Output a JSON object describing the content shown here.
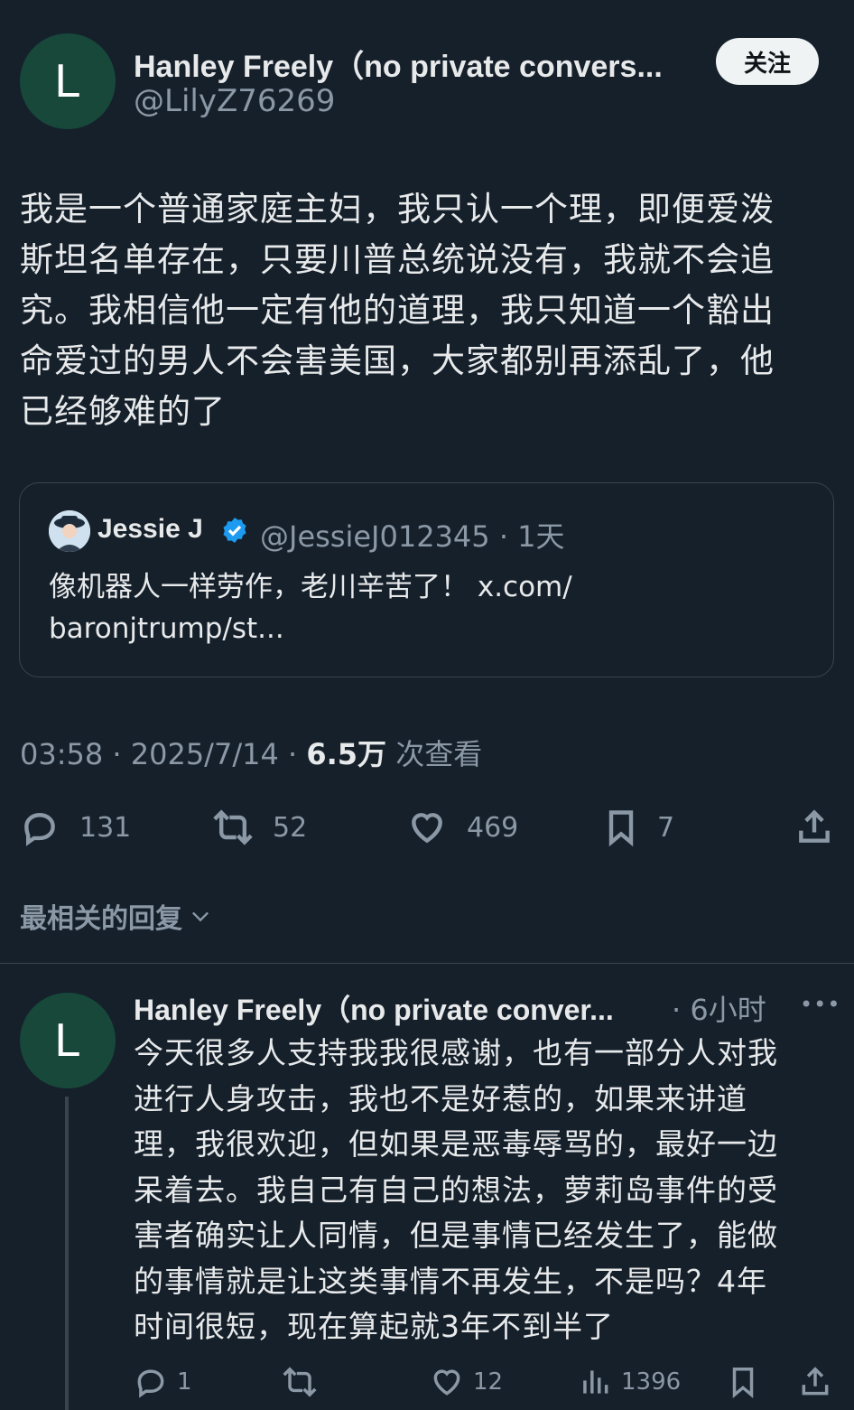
{
  "tweet": {
    "avatar_letter": "L",
    "display_name": "Hanley Freely（no private convers...",
    "handle": "@LilyZ76269",
    "follow_label": "关注",
    "text": "我是一个普通家庭主妇，我只认一个理，即便爱泼\n斯坦名单存在，只要川普总统说没有，我就不会追\n究。我相信他一定有他的道理，我只知道一个豁出\n命爱过的男人不会害美国，大家都别再添乱了，他\n已经够难的了",
    "quote": {
      "name": "Jessie J",
      "handle_time": "@JessieJ012345 · 1天",
      "text": "像机器人一样劳作，老川辛苦了！ x.com/\nbaronjtrump/st..."
    },
    "time": "03:58 · 2025/7/14 · ",
    "views_count": "6.5万",
    "views_label": " 次查看",
    "replies": "131",
    "reposts": "52",
    "likes": "469",
    "bookmarks": "7"
  },
  "replies_section": {
    "label": "最相关的回复"
  },
  "reply": {
    "avatar_letter": "L",
    "display_name": "Hanley Freely（no private conver...",
    "time": "· 6小时",
    "more": "•••",
    "text": "今天很多人支持我我很感谢，也有一部分人对我\n进行人身攻击，我也不是好惹的，如果来讲道\n理，我很欢迎，但如果是恶毒辱骂的，最好一边\n呆着去。我自己有自己的想法，萝莉岛事件的受\n害者确实让人同情，但是事情已经发生了，能做\n的事情就是让这类事情不再发生，不是吗？4年\n时间很短，现在算起就3年不到半了",
    "replies": "1",
    "likes": "12",
    "views": "1396"
  },
  "colors": {
    "background": "#15202b",
    "text": "#e7e9ea",
    "muted": "#8b98a5",
    "avatar": "#17483a",
    "verified": "#1d9bf0"
  }
}
